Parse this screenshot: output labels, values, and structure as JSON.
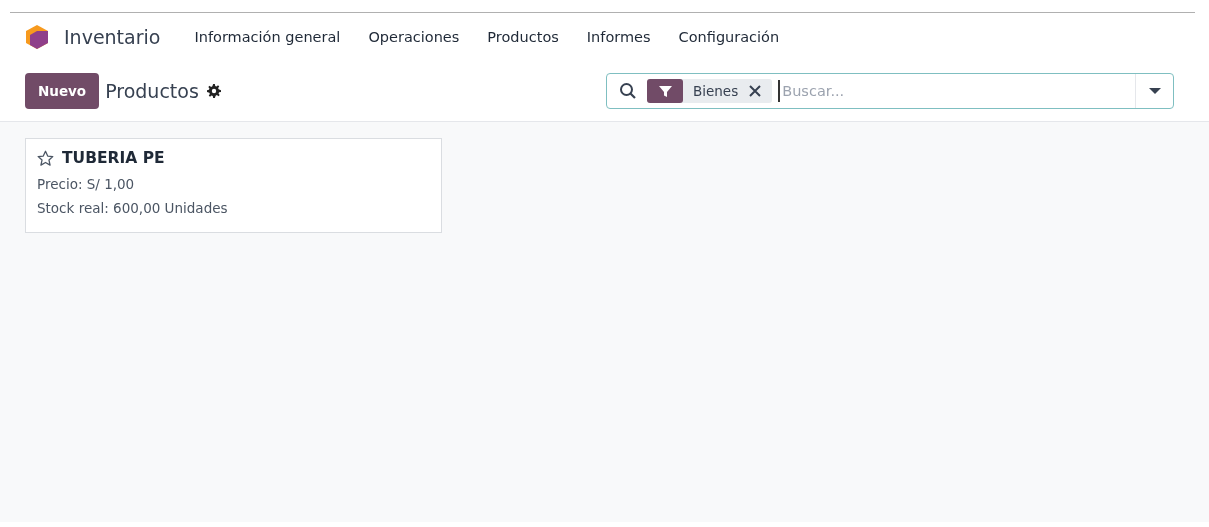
{
  "app": {
    "name": "Inventario"
  },
  "menu": [
    "Información general",
    "Operaciones",
    "Productos",
    "Informes",
    "Configuración"
  ],
  "control_panel": {
    "new_button": "Nuevo",
    "title": "Productos"
  },
  "search": {
    "facets": [
      {
        "label": "Bienes"
      }
    ],
    "placeholder": "Buscar..."
  },
  "cards": [
    {
      "name": "TUBERIA PE",
      "favorite": false,
      "lines": [
        "Precio: S/ 1,00",
        "Stock real: 600,00 Unidades"
      ]
    }
  ]
}
